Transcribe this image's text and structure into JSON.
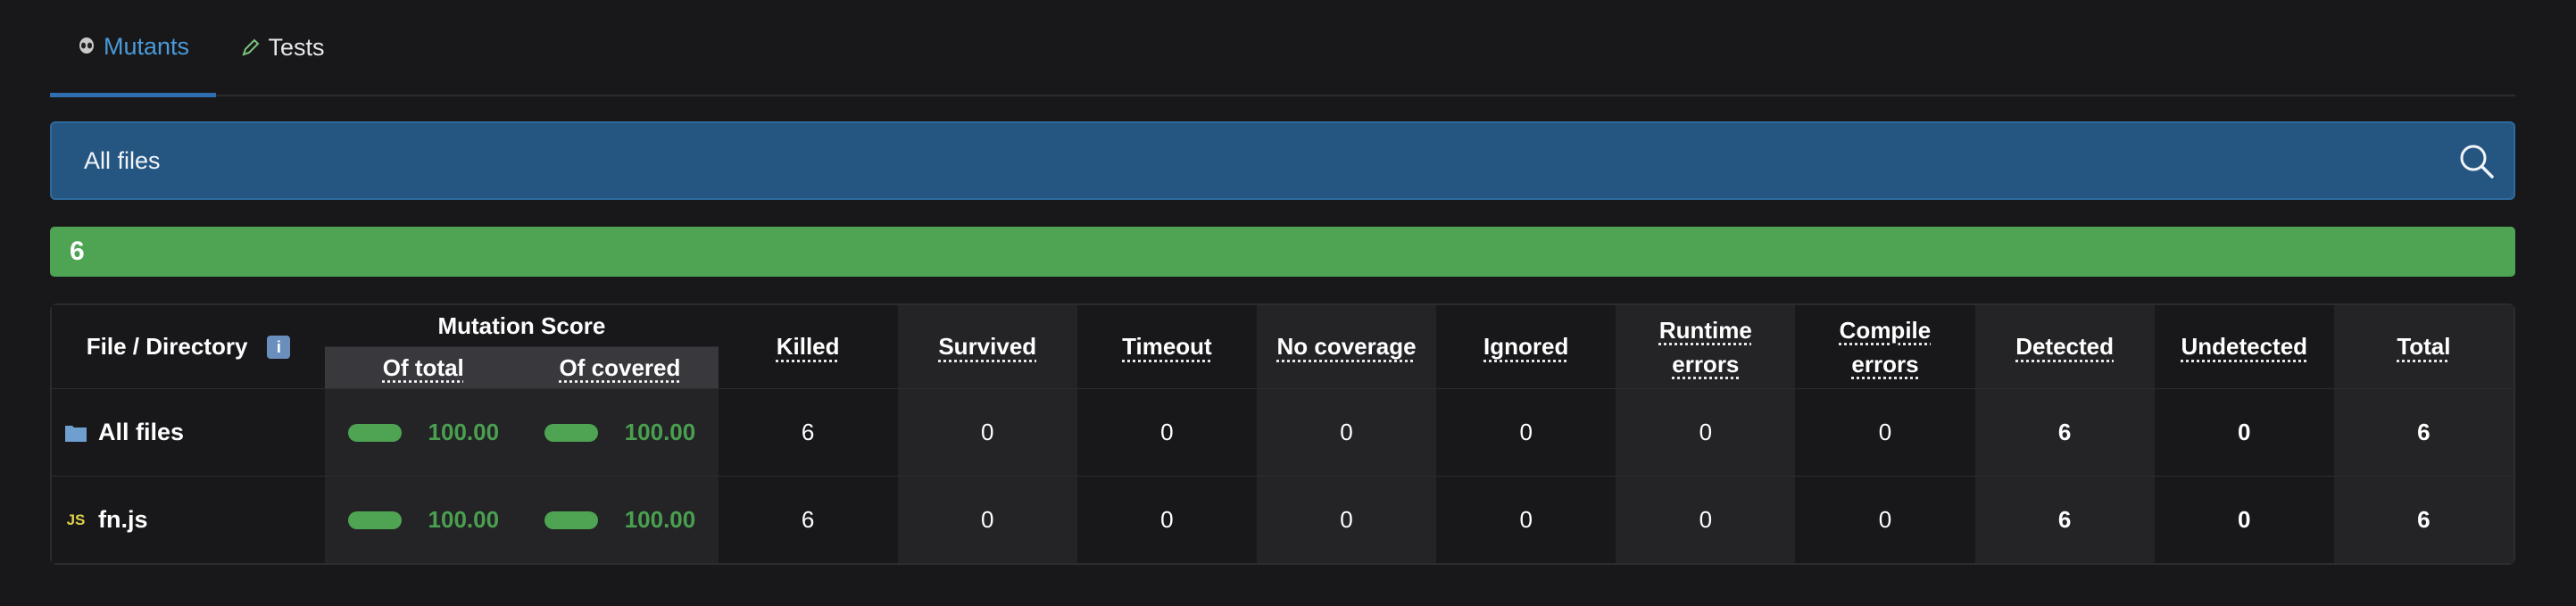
{
  "tabs": [
    {
      "label": "Mutants",
      "icon": "alien-icon",
      "active": true
    },
    {
      "label": "Tests",
      "icon": "pencil-icon",
      "active": false
    }
  ],
  "search": {
    "label": "All files",
    "icon": "search-icon"
  },
  "progress": {
    "value": "6",
    "fraction": 1.0,
    "color": "#4ea453"
  },
  "table": {
    "header": {
      "file": "File / Directory",
      "info_icon": "i",
      "mutation_score": "Mutation Score",
      "of_total": "Of total",
      "of_covered": "Of covered",
      "killed": "Killed",
      "survived": "Survived",
      "timeout": "Timeout",
      "no_coverage": "No coverage",
      "ignored": "Ignored",
      "runtime_errors": "Runtime errors",
      "compile_errors": "Compile errors",
      "detected": "Detected",
      "undetected": "Undetected",
      "total": "Total"
    },
    "rows": [
      {
        "name": "All files",
        "icon": "folder-icon",
        "of_total": "100.00",
        "of_covered": "100.00",
        "killed": "6",
        "survived": "0",
        "timeout": "0",
        "no_coverage": "0",
        "ignored": "0",
        "runtime_errors": "0",
        "compile_errors": "0",
        "detected": "6",
        "undetected": "0",
        "total": "6"
      },
      {
        "name": "fn.js",
        "icon": "js-file-icon",
        "icon_text": "JS",
        "of_total": "100.00",
        "of_covered": "100.00",
        "killed": "6",
        "survived": "0",
        "timeout": "0",
        "no_coverage": "0",
        "ignored": "0",
        "runtime_errors": "0",
        "compile_errors": "0",
        "detected": "6",
        "undetected": "0",
        "total": "6"
      }
    ]
  },
  "colors": {
    "accent": "#4a9ad8",
    "success": "#4ea453",
    "search_bg": "#255682"
  }
}
